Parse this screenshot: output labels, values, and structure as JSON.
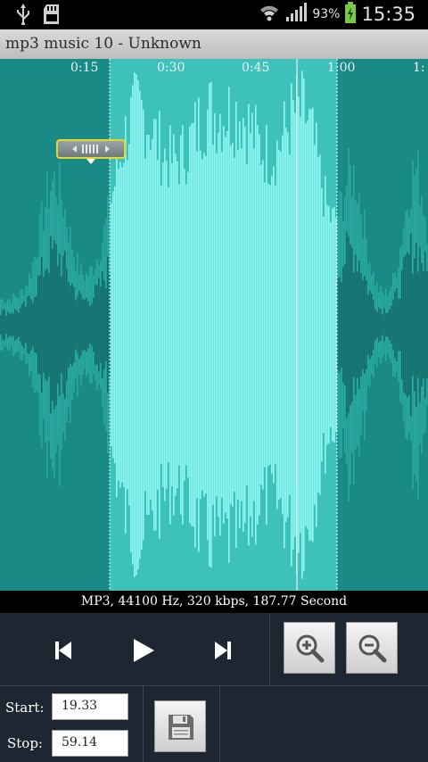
{
  "status_bar": {
    "battery_percent": "93%",
    "time": "15:35",
    "icons": [
      "usb-icon",
      "sd-card-icon",
      "wifi-icon",
      "signal-icon",
      "battery-icon"
    ]
  },
  "title_bar": {
    "title": "mp3 music 10 - Unknown"
  },
  "waveform": {
    "timeline_ticks": [
      "0:15",
      "0:30",
      "0:45",
      "1:00",
      "1:"
    ],
    "selection_start_seconds": 19.33,
    "selection_end_seconds": 59.14,
    "colors": {
      "background": "#1a8a86",
      "unselected_wave": "#2aa8a2",
      "selected_wave": "#8ff7f4",
      "selected_bg": "#3fc1bb"
    }
  },
  "info": {
    "text": "MP3, 44100 Hz, 320 kbps, 187.77 Second"
  },
  "controls": {
    "buttons": [
      "skip-to-start",
      "play",
      "skip-to-end",
      "zoom-in",
      "zoom-out"
    ],
    "start_label": "Start:",
    "start_value": "19.33",
    "stop_label": "Stop:",
    "stop_value": "59.14",
    "save_icon": "floppy-disk-icon"
  }
}
